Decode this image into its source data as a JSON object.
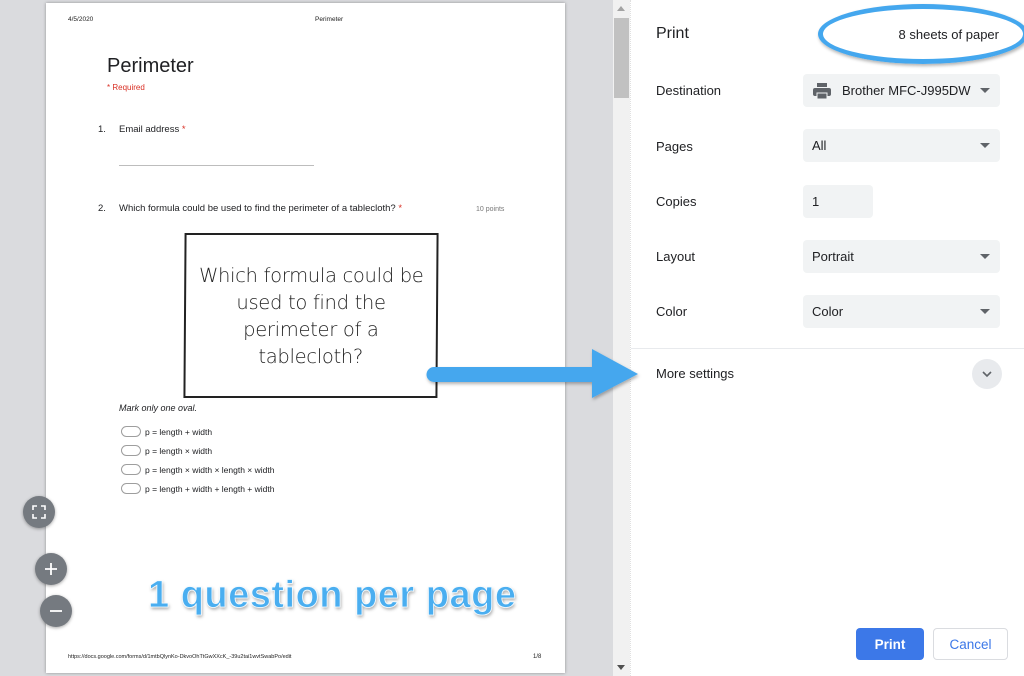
{
  "preview": {
    "header_date": "4/5/2020",
    "header_title": "Perimeter",
    "form_title": "Perimeter",
    "required_note": "* Required",
    "questions": [
      {
        "number": "1.",
        "text": "Email address",
        "required_mark": "*"
      },
      {
        "number": "2.",
        "text": "Which formula could be used to find the perimeter of a tablecloth?",
        "required_mark": "*",
        "points": "10 points",
        "image_text": "Which formula could be used to find the perimeter of a tablecloth?"
      }
    ],
    "instruction": "Mark only one oval.",
    "options": [
      "p = length + width",
      "p = length × width",
      "p = length × width × length × width",
      "p = length + width + length + width"
    ],
    "footer_url": "https://docs.google.com/forms/d/1mtbQlynKo-DkvoOhTtGwXXcK_-39u2tai1wvtSwabPo/edit",
    "footer_page": "1/8",
    "annotation": "1 question per page",
    "zoom_controls": {
      "fit_icon": "fit-to-page-icon",
      "zoom_in_icon": "plus-icon",
      "zoom_out_icon": "minus-icon"
    }
  },
  "print_panel": {
    "title": "Print",
    "sheets": "8 sheets of paper",
    "rows": {
      "destination": {
        "label": "Destination",
        "value": "Brother MFC-J995DW",
        "icon": "printer-icon"
      },
      "pages": {
        "label": "Pages",
        "value": "All"
      },
      "copies": {
        "label": "Copies",
        "value": "1"
      },
      "layout": {
        "label": "Layout",
        "value": "Portrait"
      },
      "color": {
        "label": "Color",
        "value": "Color"
      }
    },
    "more_settings": "More settings",
    "print_button": "Print",
    "cancel_button": "Cancel"
  },
  "colors": {
    "accent": "#3c78e8",
    "annotation_blue": "#44a7ee",
    "required_red": "#d93025"
  }
}
